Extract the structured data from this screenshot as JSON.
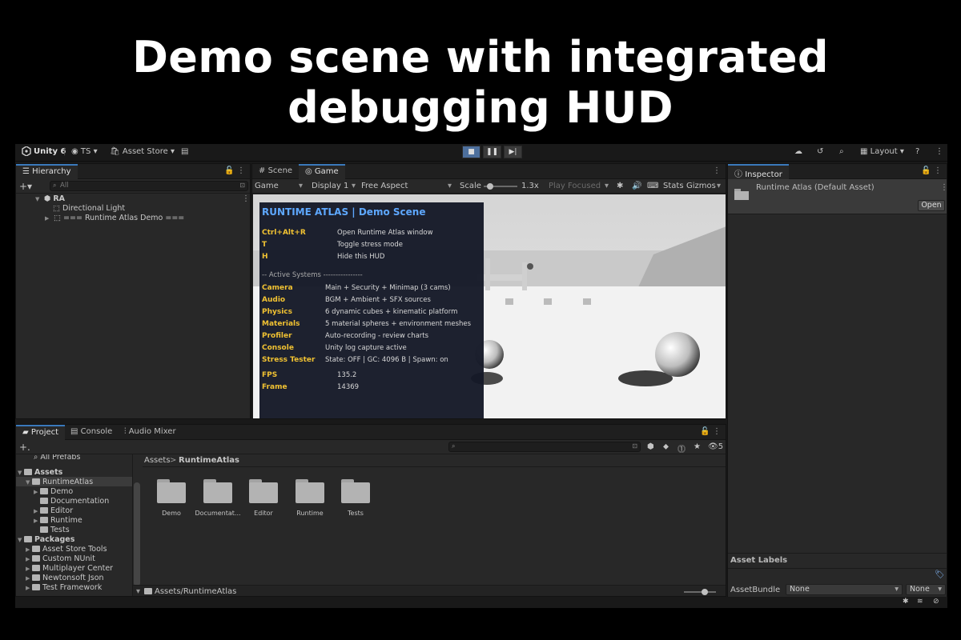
{
  "headline": "Demo scene with integrated debugging HUD",
  "toolbar": {
    "app_name": "Unity 6",
    "account": "TS",
    "asset_store": "Asset Store",
    "layout": "Layout"
  },
  "hierarchy": {
    "tab": "Hierarchy",
    "search_placeholder": "All",
    "scene": "RA",
    "items": [
      "Directional Light",
      "=== Runtime Atlas Demo ==="
    ]
  },
  "game_view": {
    "tabs": [
      "Scene",
      "Game"
    ],
    "bar": {
      "mode": "Game",
      "display": "Display 1",
      "aspect": "Free Aspect",
      "scale_label": "Scale",
      "scale_value": "1.3x",
      "play_mode": "Play Focused",
      "stats": "Stats",
      "gizmos": "Gizmos"
    },
    "scale_level": 0.12
  },
  "hud": {
    "title": "RUNTIME ATLAS  |  Demo Scene",
    "shortcuts": [
      {
        "key": "Ctrl+Alt+R",
        "desc": "Open Runtime Atlas window"
      },
      {
        "key": "T",
        "desc": "Toggle stress mode"
      },
      {
        "key": "H",
        "desc": "Hide this HUD"
      }
    ],
    "section": "-- Active Systems ----------------",
    "systems": [
      {
        "key": "Camera",
        "desc": "Main + Security + Minimap (3 cams)"
      },
      {
        "key": "Audio",
        "desc": "BGM + Ambient + SFX sources"
      },
      {
        "key": "Physics",
        "desc": "6 dynamic cubes + kinematic platform"
      },
      {
        "key": "Materials",
        "desc": "5 material spheres + environment meshes"
      },
      {
        "key": "Profiler",
        "desc": "Auto-recording - review charts"
      },
      {
        "key": "Console",
        "desc": "Unity log capture active"
      },
      {
        "key": "Stress Tester",
        "desc": "State: OFF | GC: 4096 B | Spawn: on"
      }
    ],
    "stats": [
      {
        "key": "FPS",
        "value": "135.2"
      },
      {
        "key": "Frame",
        "value": "14369"
      }
    ]
  },
  "inspector": {
    "tab": "Inspector",
    "asset_title": "Runtime Atlas (Default Asset)",
    "open_button": "Open",
    "asset_labels": "Asset Labels",
    "assetbundle_label": "AssetBundle",
    "assetbundle_value": "None",
    "variant_value": "None"
  },
  "project": {
    "tabs": [
      "Project",
      "Console",
      "Audio Mixer"
    ],
    "search_count": "5",
    "tree_top": "All Prefabs",
    "assets_root": "Assets",
    "assets_tree": [
      {
        "label": "RuntimeAtlas",
        "depth": 1,
        "selected": true,
        "open": true
      },
      {
        "label": "Demo",
        "depth": 2
      },
      {
        "label": "Documentation",
        "depth": 2,
        "leaf": true
      },
      {
        "label": "Editor",
        "depth": 2
      },
      {
        "label": "Runtime",
        "depth": 2
      },
      {
        "label": "Tests",
        "depth": 2,
        "leaf": true
      }
    ],
    "packages_root": "Packages",
    "packages": [
      "Asset Store Tools",
      "Custom NUnit",
      "Multiplayer Center",
      "Newtonsoft Json",
      "Test Framework"
    ],
    "breadcrumb": [
      "Assets",
      "RuntimeAtlas"
    ],
    "breadcrumb_sep": ">",
    "folders": [
      "Demo",
      "Documentat...",
      "Editor",
      "Runtime",
      "Tests"
    ],
    "footer_path": "Assets/RuntimeAtlas"
  },
  "colors": {
    "accent": "#3a79bb",
    "hud_key": "#f1c232",
    "hud_title": "#5ea8ff"
  }
}
